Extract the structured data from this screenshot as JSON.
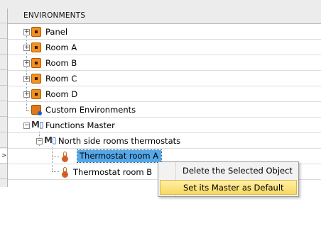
{
  "header": {
    "title": "ENVIRONMENTS"
  },
  "tree": {
    "rows": [
      {
        "label": "Panel"
      },
      {
        "label": "Room A"
      },
      {
        "label": "Room B"
      },
      {
        "label": "Room C"
      },
      {
        "label": "Room D"
      },
      {
        "label": "Custom Environments"
      },
      {
        "label": "Functions Master"
      },
      {
        "label": "North side rooms thermostats"
      },
      {
        "label": "Thermostat room A"
      },
      {
        "label": "Thermostat room B"
      }
    ],
    "row_pointer": ">"
  },
  "context_menu": {
    "items": [
      {
        "label": "Delete the Selected Object"
      },
      {
        "label": "Set its Master as Default"
      }
    ]
  },
  "icons": {
    "expand": "plus-expander-icon",
    "collapse": "minus-expander-icon",
    "environment": "orange-room-icon",
    "master": "functions-master-icon",
    "thermostat": "thermometer-icon"
  },
  "colors": {
    "selection": "#55a8e8",
    "menu_highlight": "#f8d860",
    "environment_icon": "#f09020"
  }
}
